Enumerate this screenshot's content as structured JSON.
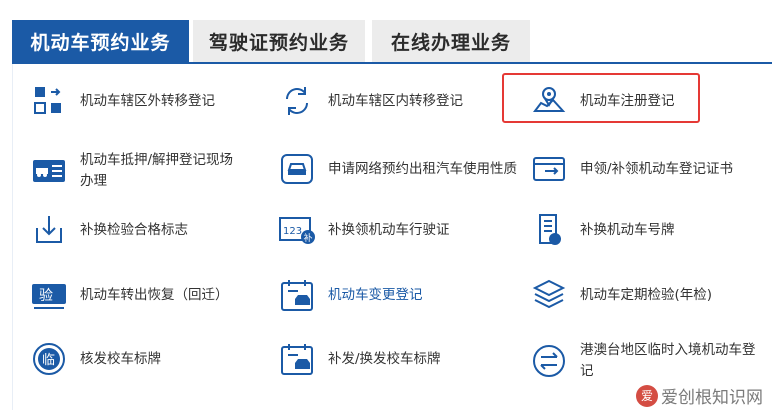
{
  "tabs": [
    {
      "label": "机动车预约业务"
    },
    {
      "label": "驾驶证预约业务"
    },
    {
      "label": "在线办理业务"
    }
  ],
  "services": [
    {
      "label": "机动车辖区外转移登记",
      "icon": "transfer-out-icon"
    },
    {
      "label": "机动车辖区内转移登记",
      "icon": "refresh-icon"
    },
    {
      "label": "机动车注册登记",
      "icon": "map-pin-icon"
    },
    {
      "label": "机动车抵押/解押登记现场办理",
      "icon": "id-card-icon"
    },
    {
      "label": "申请网络预约出租汽车使用性质",
      "icon": "car-icon"
    },
    {
      "label": "申领/补领机动车登记证书",
      "icon": "certificate-icon"
    },
    {
      "label": "补换检验合格标志",
      "icon": "download-icon"
    },
    {
      "label": "补换领机动车行驶证",
      "icon": "license-card-icon"
    },
    {
      "label": "补换机动车号牌",
      "icon": "plate-document-icon"
    },
    {
      "label": "机动车转出恢复（回迁）",
      "icon": "verify-badge-icon"
    },
    {
      "label": "机动车变更登记",
      "icon": "calendar-car-icon"
    },
    {
      "label": "机动车定期检验(年检)",
      "icon": "layers-icon"
    },
    {
      "label": "核发校车标牌",
      "icon": "circle-badge-icon"
    },
    {
      "label": "补发/换发校车标牌",
      "icon": "calendar-bus-icon"
    },
    {
      "label": "港澳台地区临时入境机动车登记",
      "icon": "swap-icon"
    }
  ],
  "icon_text": {
    "verify": "验",
    "temp": "临",
    "plate_digits": "123",
    "plate_char": "补"
  },
  "watermark": {
    "badge": "爱",
    "text": "爱创根知识网"
  },
  "colors": {
    "brand_blue": "#1b5aa6",
    "highlight_red": "#e53935"
  }
}
